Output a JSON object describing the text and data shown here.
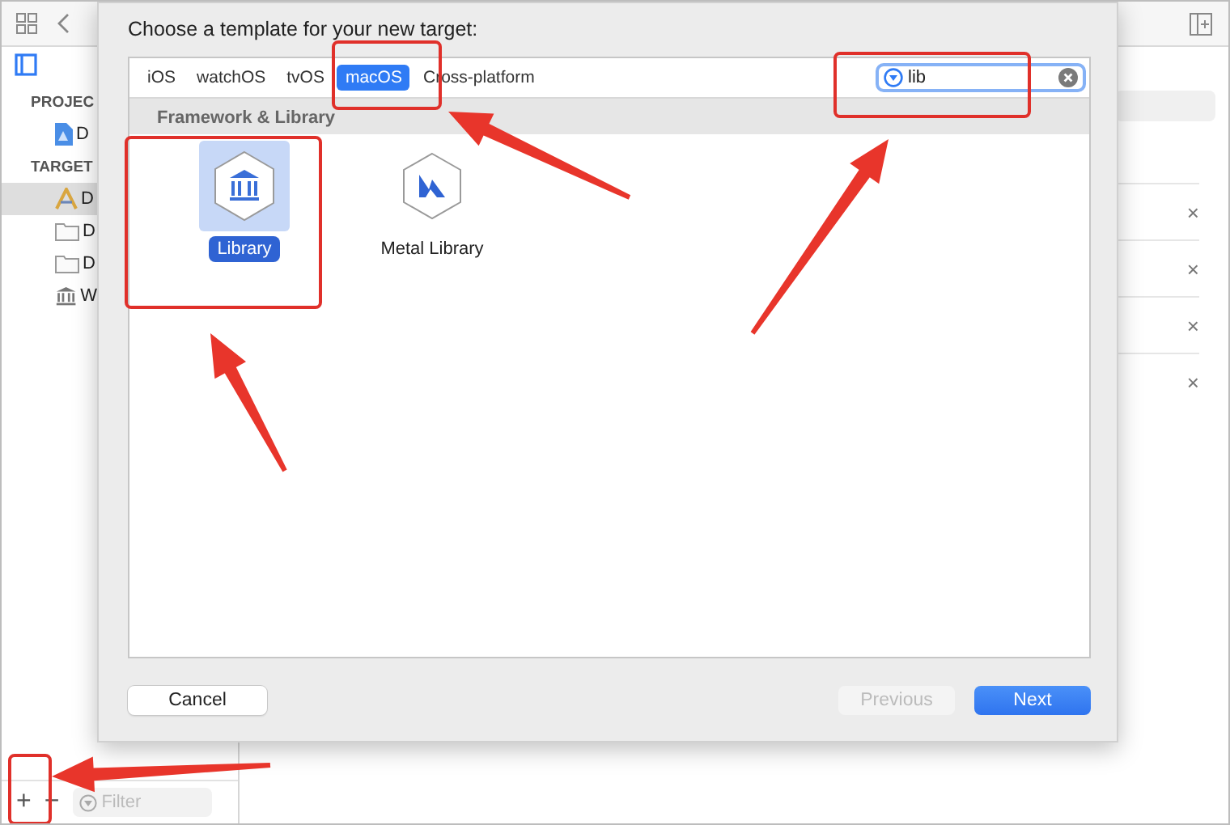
{
  "sidebar": {
    "sections": [
      {
        "title": "PROJEC",
        "items": [
          {
            "label": "D",
            "kind": "project",
            "selected": false
          }
        ]
      },
      {
        "title": "TARGET",
        "items": [
          {
            "label": "D",
            "kind": "app",
            "selected": true
          },
          {
            "label": "D",
            "kind": "folder",
            "selected": false
          },
          {
            "label": "D",
            "kind": "folder",
            "selected": false
          },
          {
            "label": "W",
            "kind": "bank",
            "selected": false
          }
        ]
      }
    ],
    "bottom": {
      "add": "+",
      "remove": "−",
      "filter": {
        "placeholder": "Filter"
      }
    }
  },
  "editor": {
    "rows": [
      {
        "remove": "×"
      },
      {
        "remove": "×"
      },
      {
        "remove": "×"
      },
      {
        "remove": "×"
      }
    ]
  },
  "dialog": {
    "title": "Choose a template for your new target:",
    "tabs": [
      {
        "label": "iOS",
        "selected": false
      },
      {
        "label": "watchOS",
        "selected": false
      },
      {
        "label": "tvOS",
        "selected": false
      },
      {
        "label": "macOS",
        "selected": true
      },
      {
        "label": "Cross-platform",
        "selected": false
      }
    ],
    "search": {
      "value": "lib"
    },
    "section": "Framework & Library",
    "templates": [
      {
        "label": "Library",
        "kind": "library",
        "selected": true
      },
      {
        "label": "Metal Library",
        "kind": "metal",
        "selected": false
      }
    ],
    "buttons": [
      {
        "label": "Cancel",
        "kind": "default",
        "disabled": false
      },
      {
        "label": "Previous",
        "kind": "default",
        "disabled": true
      },
      {
        "label": "Next",
        "kind": "primary",
        "disabled": false
      }
    ]
  }
}
